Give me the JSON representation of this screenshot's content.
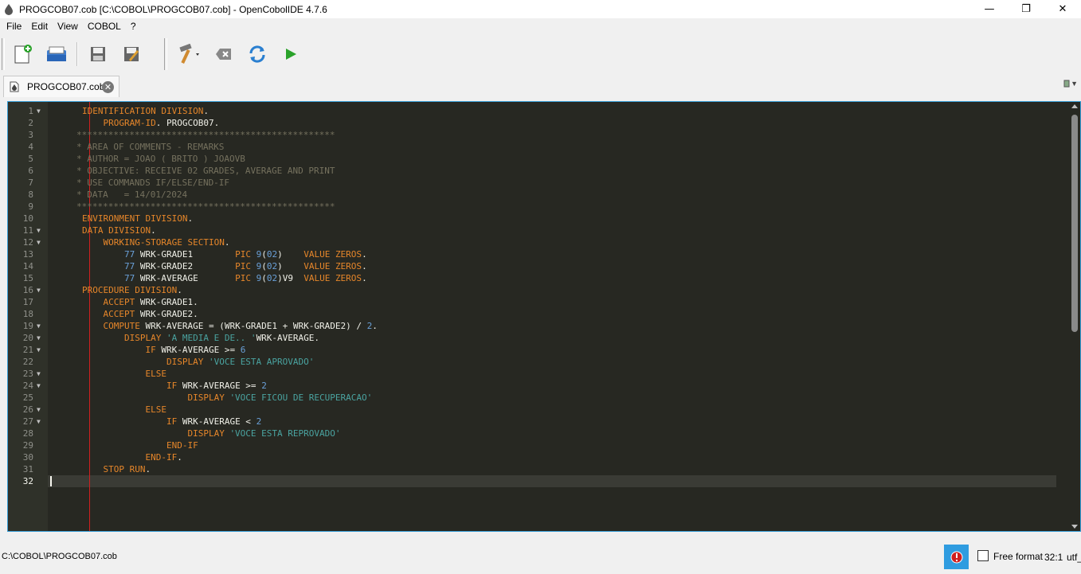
{
  "window": {
    "title": "PROGCOB07.cob [C:\\COBOL\\PROGCOB07.cob] - OpenCobolIDE 4.7.6"
  },
  "menu": [
    "File",
    "Edit",
    "View",
    "COBOL",
    "?"
  ],
  "toolbar": {
    "buttons": [
      "new-file",
      "open-file",
      "save-file",
      "save-as",
      "compile",
      "clean",
      "rebuild",
      "run"
    ]
  },
  "tab": {
    "label": "PROGCOB07.cob"
  },
  "editor": {
    "lines": [
      {
        "n": "1",
        "fold": true,
        "segs": [
          [
            "kw",
            "IDENTIFICATION DIVISION"
          ],
          [
            "id",
            "."
          ]
        ]
      },
      {
        "n": "2",
        "fold": false,
        "segs": [
          [
            "id",
            "    "
          ],
          [
            "kw",
            "PROGRAM-ID"
          ],
          [
            "id",
            ". PROGCOB07."
          ]
        ]
      },
      {
        "n": "3",
        "fold": false,
        "segs": [
          [
            "cm",
            "*************************************************"
          ]
        ],
        "shift": true
      },
      {
        "n": "4",
        "fold": false,
        "segs": [
          [
            "cm",
            "* AREA OF COMMENTS - REMARKS"
          ]
        ],
        "shift": true
      },
      {
        "n": "5",
        "fold": false,
        "segs": [
          [
            "cm",
            "* AUTHOR = JOAO ( BRITO ) JOAOVB"
          ]
        ],
        "shift": true
      },
      {
        "n": "6",
        "fold": false,
        "segs": [
          [
            "cm",
            "* OBJECTIVE: RECEIVE 02 GRADES, AVERAGE AND PRINT"
          ]
        ],
        "shift": true
      },
      {
        "n": "7",
        "fold": false,
        "segs": [
          [
            "cm",
            "* USE COMMANDS IF/ELSE/END-IF"
          ]
        ],
        "shift": true
      },
      {
        "n": "8",
        "fold": false,
        "segs": [
          [
            "cm",
            "* DATA   = 14/01/2024"
          ]
        ],
        "shift": true
      },
      {
        "n": "9",
        "fold": false,
        "segs": [
          [
            "cm",
            "*************************************************"
          ]
        ],
        "shift": true
      },
      {
        "n": "10",
        "fold": false,
        "segs": [
          [
            "kw",
            "ENVIRONMENT DIVISION"
          ],
          [
            "id",
            "."
          ]
        ]
      },
      {
        "n": "11",
        "fold": true,
        "segs": [
          [
            "kw",
            "DATA DIVISION"
          ],
          [
            "id",
            "."
          ]
        ]
      },
      {
        "n": "12",
        "fold": true,
        "segs": [
          [
            "id",
            "    "
          ],
          [
            "kw",
            "WORKING-STORAGE SECTION"
          ],
          [
            "id",
            "."
          ]
        ]
      },
      {
        "n": "13",
        "fold": false,
        "segs": [
          [
            "id",
            "        "
          ],
          [
            "nm",
            "77"
          ],
          [
            "id",
            " WRK-GRADE1        "
          ],
          [
            "kw",
            "PIC"
          ],
          [
            "id",
            " "
          ],
          [
            "nm",
            "9"
          ],
          [
            "id",
            "("
          ],
          [
            "nm",
            "02"
          ],
          [
            "id",
            ")    "
          ],
          [
            "kw",
            "VALUE ZEROS"
          ],
          [
            "id",
            "."
          ]
        ]
      },
      {
        "n": "14",
        "fold": false,
        "segs": [
          [
            "id",
            "        "
          ],
          [
            "nm",
            "77"
          ],
          [
            "id",
            " WRK-GRADE2        "
          ],
          [
            "kw",
            "PIC"
          ],
          [
            "id",
            " "
          ],
          [
            "nm",
            "9"
          ],
          [
            "id",
            "("
          ],
          [
            "nm",
            "02"
          ],
          [
            "id",
            ")    "
          ],
          [
            "kw",
            "VALUE ZEROS"
          ],
          [
            "id",
            "."
          ]
        ]
      },
      {
        "n": "15",
        "fold": false,
        "segs": [
          [
            "id",
            "        "
          ],
          [
            "nm",
            "77"
          ],
          [
            "id",
            " WRK-AVERAGE       "
          ],
          [
            "kw",
            "PIC"
          ],
          [
            "id",
            " "
          ],
          [
            "nm",
            "9"
          ],
          [
            "id",
            "("
          ],
          [
            "nm",
            "02"
          ],
          [
            "id",
            ")V9  "
          ],
          [
            "kw",
            "VALUE ZEROS"
          ],
          [
            "id",
            "."
          ]
        ]
      },
      {
        "n": "16",
        "fold": true,
        "segs": [
          [
            "kw",
            "PROCEDURE DIVISION"
          ],
          [
            "id",
            "."
          ]
        ]
      },
      {
        "n": "17",
        "fold": false,
        "segs": [
          [
            "id",
            "    "
          ],
          [
            "kw",
            "ACCEPT"
          ],
          [
            "id",
            " WRK-GRADE1."
          ]
        ]
      },
      {
        "n": "18",
        "fold": false,
        "segs": [
          [
            "id",
            "    "
          ],
          [
            "kw",
            "ACCEPT"
          ],
          [
            "id",
            " WRK-GRADE2."
          ]
        ]
      },
      {
        "n": "19",
        "fold": true,
        "segs": [
          [
            "id",
            "    "
          ],
          [
            "kw",
            "COMPUTE"
          ],
          [
            "id",
            " WRK-AVERAGE = (WRK-GRADE1 + WRK-GRADE2) / "
          ],
          [
            "nm",
            "2"
          ],
          [
            "id",
            "."
          ]
        ]
      },
      {
        "n": "20",
        "fold": true,
        "segs": [
          [
            "id",
            "        "
          ],
          [
            "kw",
            "DISPLAY"
          ],
          [
            "id",
            " "
          ],
          [
            "st",
            "'A MEDIA E DE.. '"
          ],
          [
            "id",
            "WRK-AVERAGE."
          ]
        ]
      },
      {
        "n": "21",
        "fold": true,
        "segs": [
          [
            "id",
            "            "
          ],
          [
            "kw",
            "IF"
          ],
          [
            "id",
            " WRK-AVERAGE >= "
          ],
          [
            "nm",
            "6"
          ]
        ]
      },
      {
        "n": "22",
        "fold": false,
        "segs": [
          [
            "id",
            "                "
          ],
          [
            "kw",
            "DISPLAY"
          ],
          [
            "id",
            " "
          ],
          [
            "st",
            "'VOCE ESTA APROVADO'"
          ]
        ]
      },
      {
        "n": "23",
        "fold": true,
        "segs": [
          [
            "id",
            "            "
          ],
          [
            "kw",
            "ELSE"
          ]
        ]
      },
      {
        "n": "24",
        "fold": true,
        "segs": [
          [
            "id",
            "                "
          ],
          [
            "kw",
            "IF"
          ],
          [
            "id",
            " WRK-AVERAGE >= "
          ],
          [
            "nm",
            "2"
          ]
        ]
      },
      {
        "n": "25",
        "fold": false,
        "segs": [
          [
            "id",
            "                    "
          ],
          [
            "kw",
            "DISPLAY"
          ],
          [
            "id",
            " "
          ],
          [
            "st",
            "'VOCE FICOU DE RECUPERACAO'"
          ]
        ]
      },
      {
        "n": "26",
        "fold": true,
        "segs": [
          [
            "id",
            "            "
          ],
          [
            "kw",
            "ELSE"
          ]
        ]
      },
      {
        "n": "27",
        "fold": true,
        "segs": [
          [
            "id",
            "                "
          ],
          [
            "kw",
            "IF"
          ],
          [
            "id",
            " WRK-AVERAGE < "
          ],
          [
            "nm",
            "2"
          ]
        ]
      },
      {
        "n": "28",
        "fold": false,
        "segs": [
          [
            "id",
            "                    "
          ],
          [
            "kw",
            "DISPLAY"
          ],
          [
            "id",
            " "
          ],
          [
            "st",
            "'VOCE ESTA REPROVADO'"
          ]
        ]
      },
      {
        "n": "29",
        "fold": false,
        "segs": [
          [
            "id",
            "                "
          ],
          [
            "kw",
            "END-IF"
          ]
        ]
      },
      {
        "n": "30",
        "fold": false,
        "segs": [
          [
            "id",
            "            "
          ],
          [
            "kw",
            "END-IF"
          ],
          [
            "id",
            "."
          ]
        ]
      },
      {
        "n": "31",
        "fold": false,
        "segs": [
          [
            "id",
            "    "
          ],
          [
            "kw",
            "STOP RUN"
          ],
          [
            "id",
            "."
          ]
        ]
      },
      {
        "n": "32",
        "fold": false,
        "segs": []
      }
    ]
  },
  "status": {
    "path": "C:\\COBOL\\PROGCOB07.cob",
    "free_format_label": "Free format",
    "cursor": "32:1",
    "encoding": "utf_"
  },
  "colors": {
    "keyword": "#e6862a",
    "comment": "#75715e",
    "string": "#4aa3a0",
    "number": "#6aa0d8",
    "accent": "#2f9ce0"
  }
}
